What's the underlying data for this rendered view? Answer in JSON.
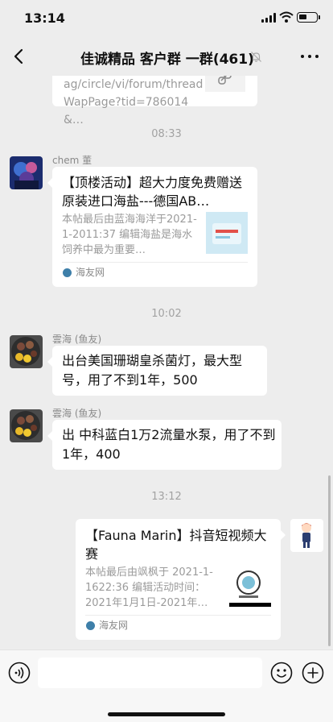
{
  "status_bar": {
    "time": "13:14"
  },
  "nav": {
    "title": "佳诚精品 客户群 一群(461)"
  },
  "messages": {
    "partial_card": {
      "url_text": "ag/circle/vi/forum/threadWapPage?tid=786014&…"
    },
    "ts1": "08:33",
    "msg1": {
      "sender": "chem 董",
      "title": "【顶楼活动】超大力度免费赠送原装进口海盐---德国AB…",
      "desc": "本帖最后由蓝海海洋于2021-1-2011:37 编辑海盐是海水饲养中最为重要…",
      "source": "海友网"
    },
    "ts2": "10:02",
    "msg2": {
      "sender": "雲海 (鱼友)",
      "text": "出台美国珊瑚皇杀菌灯，最大型号，用了不到1年，500"
    },
    "msg3": {
      "sender": "雲海 (鱼友)",
      "text": "出 中科蓝白1万2流量水泵，用了不到1年，400"
    },
    "ts3": "13:12",
    "msg4": {
      "title": "【Fauna Marin】抖音短视频大赛",
      "desc": "本帖最后由飒枫于 2021-1-1622:36 编辑活动时间：2021年1月1日-2021年…",
      "source": "海友网"
    }
  },
  "icons": {
    "back": "back-arrow-icon",
    "mute": "mute-bell-icon",
    "more": "more-dots-icon",
    "voice": "voice-icon",
    "emoji": "emoji-icon",
    "plus": "plus-icon"
  },
  "colors": {
    "background": "#ededed",
    "bubble": "#ffffff",
    "timestamp": "#a2a2a2",
    "source_icon": "#3e7fa9"
  }
}
